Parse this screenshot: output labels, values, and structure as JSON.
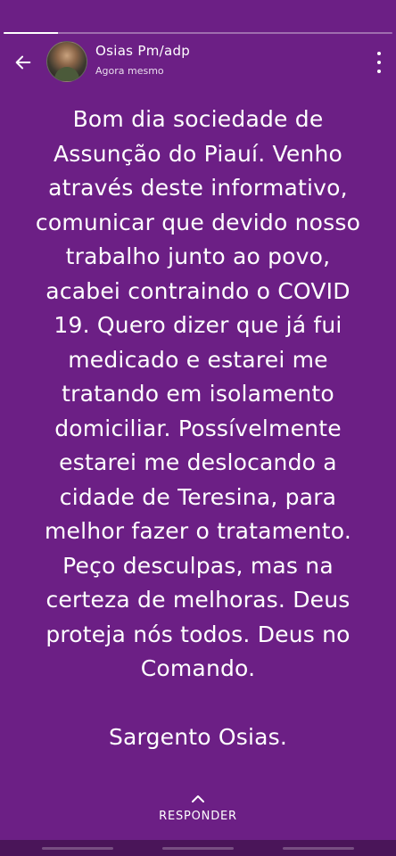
{
  "story": {
    "progress_fraction": 0.14,
    "header": {
      "user_name": "Osias Pm/adp",
      "timestamp": "Agora mesmo",
      "back_icon": "arrow-left-icon",
      "more_icon": "more-vertical-icon"
    },
    "text_lines": [
      "Bom dia sociedade de",
      "Assunção do Piauí. Venho",
      "através deste informativo,",
      "comunicar que devido nosso",
      "trabalho junto ao povo,",
      "acabei contraindo o COVID",
      "19. Quero dizer que já fui",
      "medicado e estarei me",
      "tratando em isolamento",
      "domiciliar. Possívelmente",
      "estarei  me deslocando a",
      "cidade de Teresina, para",
      "melhor fazer o tratamento.",
      "Peço desculpas, mas na",
      "certeza de melhoras. Deus",
      "proteja nós todos. Deus no",
      "Comando.",
      "",
      "Sargento Osias."
    ],
    "reply": {
      "label": "RESPONDER",
      "icon": "chevron-up-icon"
    },
    "colors": {
      "background": "#6c1f85",
      "text": "#ffffff",
      "nav_bar": "#4a1559"
    }
  }
}
